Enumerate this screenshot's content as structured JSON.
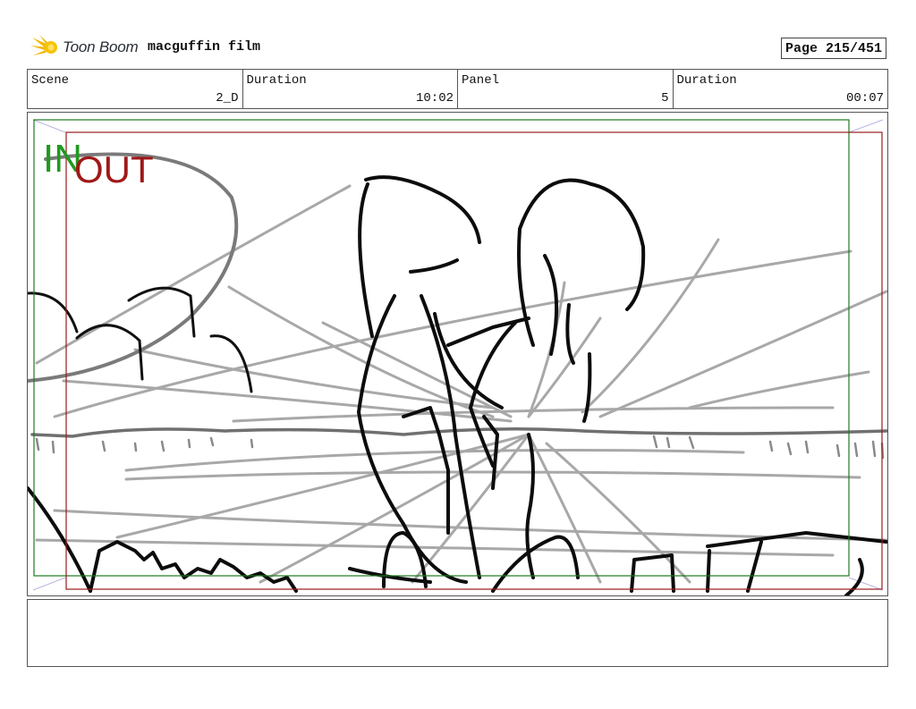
{
  "header": {
    "logo_text": "Toon Boom",
    "film_title": "macguffin film",
    "page_label": "Page 215/451"
  },
  "info": {
    "scene_label": "Scene",
    "scene_value": "2_D",
    "duration_label": "Duration",
    "duration_value": "10:02",
    "panel_label": "Panel",
    "panel_value": "5",
    "panel_duration_label": "Duration",
    "panel_duration_value": "00:07"
  },
  "panel": {
    "in_label": "IN",
    "out_label": "OUT",
    "in_color": "#1f9a1f",
    "out_color": "#a01818"
  },
  "notes": {
    "text": ""
  }
}
